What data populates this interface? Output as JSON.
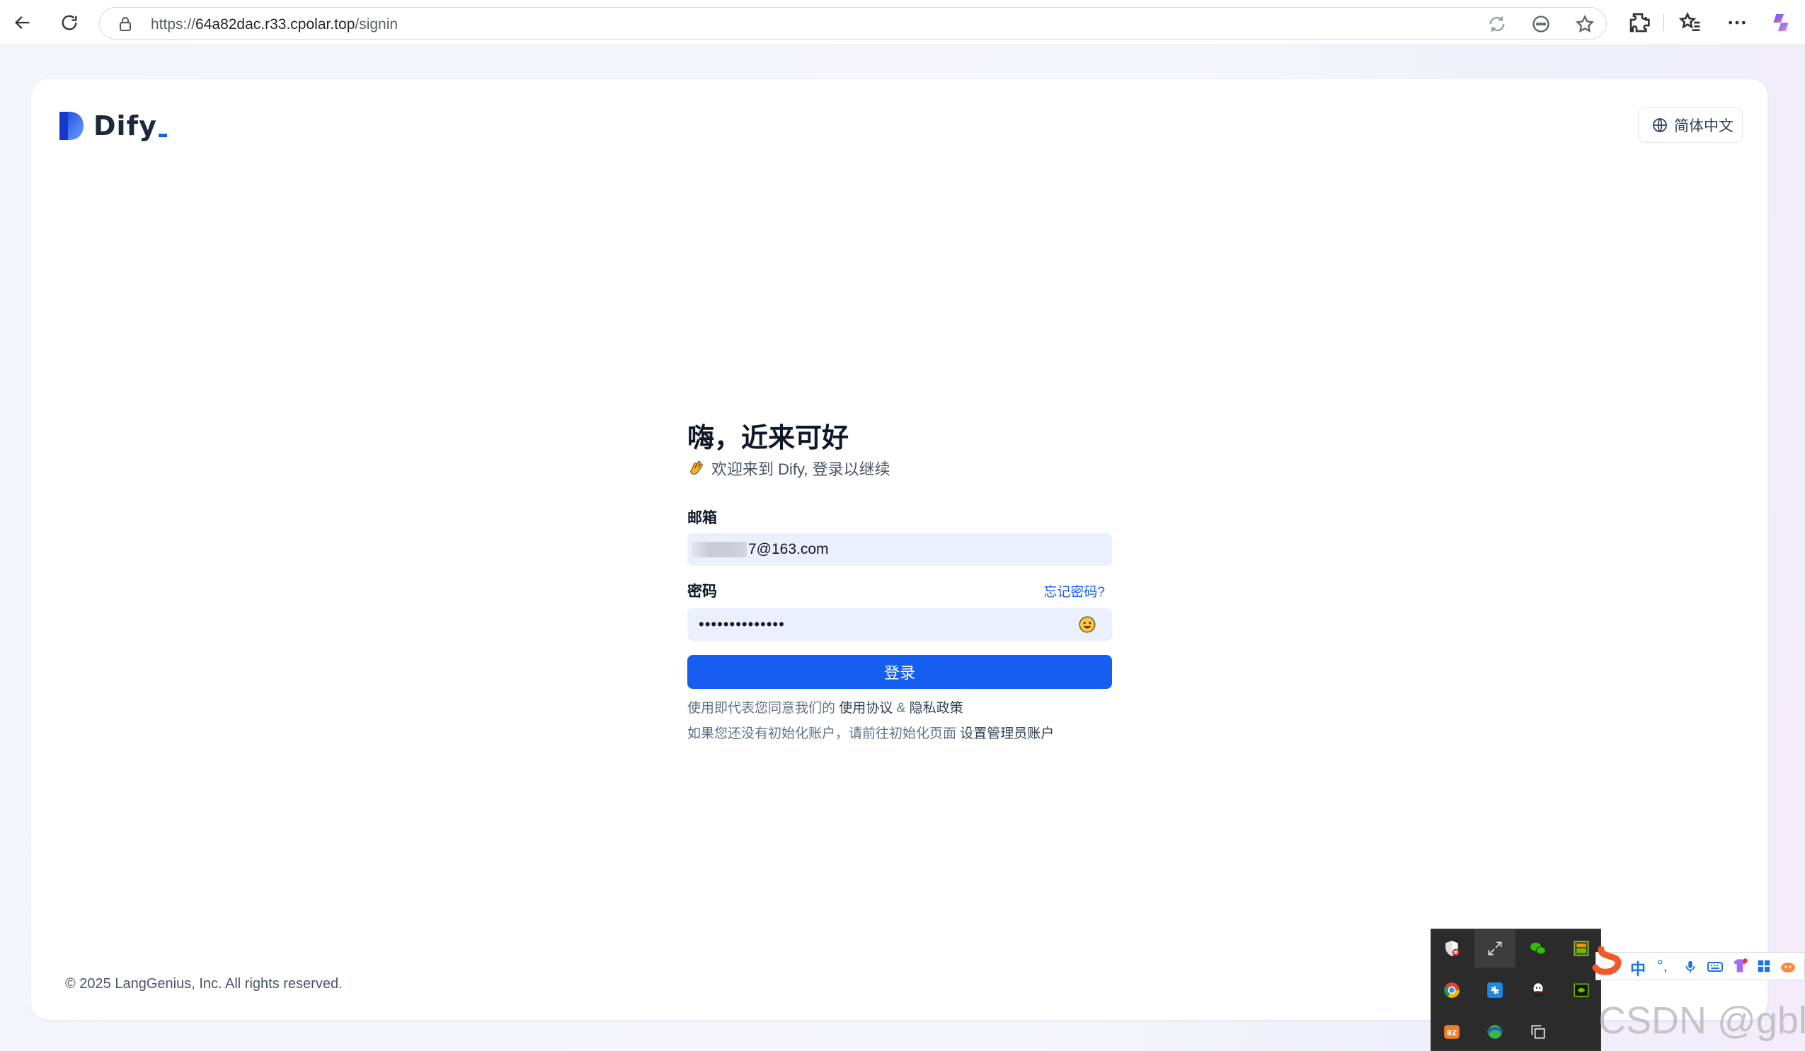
{
  "browser": {
    "url_prefix": "https://",
    "url_host": "64a82dac.r33.cpolar.top",
    "url_path": "/signin"
  },
  "header": {
    "logo_text": "Dify",
    "language_label": "简体中文"
  },
  "signin": {
    "title": "嗨，近来可好",
    "subtitle": "欢迎来到 Dify, 登录以继续",
    "email_label": "邮箱",
    "email_value_suffix": "7@163.com",
    "password_label": "密码",
    "forgot_link": "忘记密码?",
    "password_value": "••••••••••••••",
    "login_button": "登录",
    "terms_prefix": "使用即代表您同意我们的",
    "terms_link": "使用协议",
    "terms_and": "&",
    "privacy_link": "隐私政策",
    "setup_prefix": "如果您还没有初始化账户，请前往初始化页面",
    "setup_link": "设置管理员账户"
  },
  "footer": {
    "copyright": "© 2025 LangGenius, Inc. All rights reserved."
  },
  "system_tray": {
    "icons": [
      "defender-icon",
      "resize-icon",
      "wechat-icon",
      "gpu-monitor-icon",
      "chrome-icon",
      "network-app-icon",
      "qq-icon",
      "nvidia-icon",
      "bilibili-icon",
      "edge-icon",
      "windows-copy-icon"
    ]
  },
  "ime": {
    "items": [
      "中",
      "°,"
    ]
  },
  "watermark": "CSDN @gblfy",
  "colors": {
    "primary": "#155eef",
    "input_bg": "#eaf0fd"
  }
}
